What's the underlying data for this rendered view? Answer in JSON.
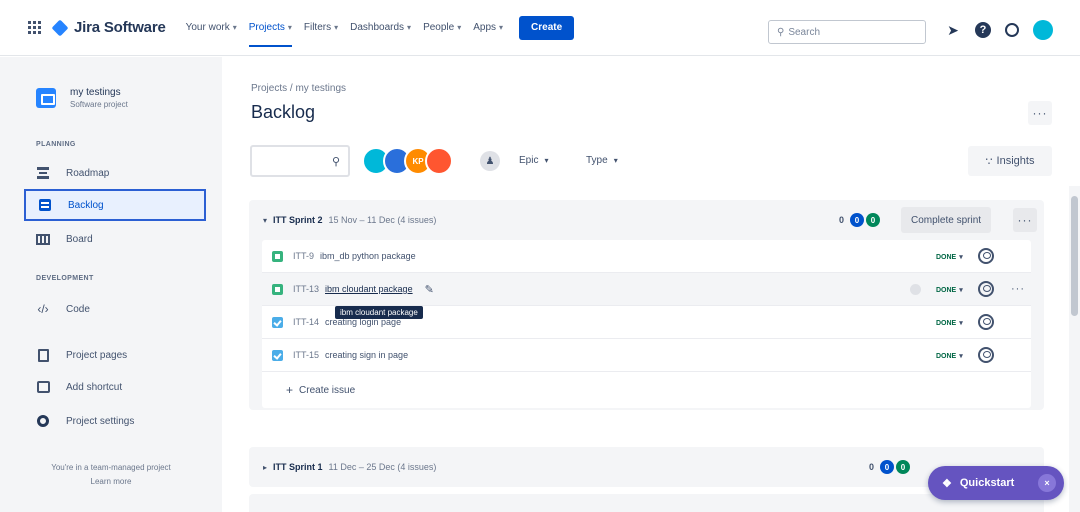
{
  "nav": {
    "app_name": "Jira Software",
    "items": [
      {
        "label": "Your work",
        "active": false
      },
      {
        "label": "Projects",
        "active": true
      },
      {
        "label": "Filters",
        "active": false
      },
      {
        "label": "Dashboards",
        "active": false
      },
      {
        "label": "People",
        "active": false
      },
      {
        "label": "Apps",
        "active": false
      }
    ],
    "create_label": "Create",
    "search_placeholder": "Search",
    "icons": [
      "notifications-icon",
      "help-icon",
      "settings-icon",
      "profile-avatar"
    ],
    "accent_color": "#0052cc"
  },
  "sidebar": {
    "project_name": "my testings",
    "project_type": "Software project",
    "planning_heading": "PLANNING",
    "development_heading": "DEVELOPMENT",
    "items": [
      {
        "label": "Roadmap"
      },
      {
        "label": "Backlog"
      },
      {
        "label": "Board"
      },
      {
        "label": "Code"
      },
      {
        "label": "Project pages"
      },
      {
        "label": "Add shortcut"
      },
      {
        "label": "Project settings"
      }
    ],
    "footer_text": "You're in a team-managed project",
    "learn_more": "Learn more"
  },
  "main": {
    "breadcrumb": "Projects  /  my testings",
    "title": "Backlog",
    "filters": {
      "epic_label": "Epic",
      "type_label": "Type",
      "avatar_initials": [
        "",
        "",
        "KP",
        ""
      ],
      "avatar_colors": [
        "#00b8d9",
        "#2a6fdb",
        "#ff8b00",
        "#ff5630"
      ]
    },
    "insights_label": "Insights"
  },
  "sprint2": {
    "name": "ITT Sprint 2",
    "dates": "15 Nov – 11 Dec (4 issues)",
    "counts": [
      "0",
      "0",
      "0"
    ],
    "action_label": "Complete sprint",
    "issues": [
      {
        "key": "ITT-9",
        "summary": "ibm_db python package",
        "type": "story",
        "status": "DONE"
      },
      {
        "key": "ITT-13",
        "summary": "ibm cloudant package",
        "type": "story",
        "status": "DONE"
      },
      {
        "key": "ITT-14",
        "summary": "creating login page",
        "type": "task",
        "status": "DONE"
      },
      {
        "key": "ITT-15",
        "summary": "creating sign in page",
        "type": "task",
        "status": "DONE"
      }
    ],
    "create_issue_label": "Create issue",
    "tooltip": "ibm cloudant package"
  },
  "sprint1": {
    "name": "ITT Sprint 1",
    "dates": "11 Dec – 25 Dec (4 issues)",
    "counts": [
      "0",
      "0",
      "0"
    ]
  },
  "quickstart": {
    "label": "Quickstart",
    "close": "×",
    "color": "#6554c0"
  }
}
